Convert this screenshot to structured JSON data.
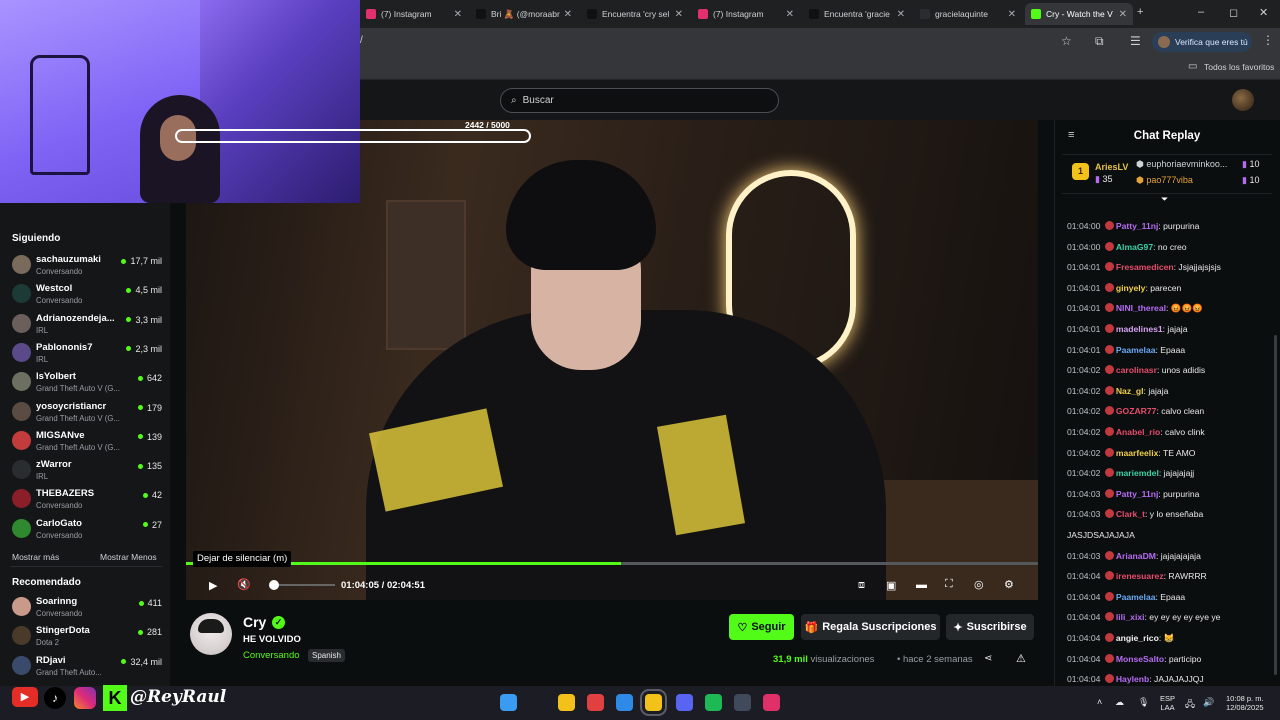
{
  "browser": {
    "tabs": [
      {
        "label": "(7) Instagram",
        "color": "#e1306c"
      },
      {
        "label": "Bri 🧸 (@moraabr",
        "color": "#111111"
      },
      {
        "label": "Encuentra 'cry sel",
        "color": "#111111"
      },
      {
        "label": "(7) Instagram",
        "color": "#e1306c"
      },
      {
        "label": "Encuentra 'gracie",
        "color": "#111111"
      },
      {
        "label": "gracielaquinte",
        "color": "#2a2d30"
      },
      {
        "label": "Cry - Watch the V",
        "color": "#53fc18"
      }
    ],
    "new_tab": "+",
    "window_controls": [
      "–",
      "◻",
      "✕"
    ],
    "url_fragment": "/",
    "verify_chip": "Verifica que eres tú",
    "bookmarks_label": "Todos los favoritos"
  },
  "header": {
    "search_placeholder": "Buscar"
  },
  "sidebar": {
    "following_title": "Siguiendo",
    "channels": [
      {
        "name": "sachauzumaki",
        "sub": "Conversando",
        "viewers": "17,7 mil",
        "color": "#7a6a5c"
      },
      {
        "name": "Westcol",
        "sub": "Conversando",
        "viewers": "4,5 mil",
        "color": "#1d3b36"
      },
      {
        "name": "Adrianozendeja...",
        "sub": "IRL",
        "viewers": "3,3 mil",
        "color": "#6a5f5a"
      },
      {
        "name": "Pablononis7",
        "sub": "IRL",
        "viewers": "2,3 mil",
        "color": "#5b4a8a"
      },
      {
        "name": "lsYolbert",
        "sub": "Grand Theft Auto V (G...",
        "viewers": "642",
        "color": "#6d7060"
      },
      {
        "name": "yosoycristiancr",
        "sub": "Grand Theft Auto V (G...",
        "viewers": "179",
        "color": "#5a4c43"
      },
      {
        "name": "MIGSANve",
        "sub": "Grand Theft Auto V (G...",
        "viewers": "139",
        "color": "#c23c3c"
      },
      {
        "name": "zWarror",
        "sub": "IRL",
        "viewers": "135",
        "color": "#2a2d30"
      },
      {
        "name": "THEBAZERS",
        "sub": "Conversando",
        "viewers": "42",
        "color": "#8a1f2a"
      },
      {
        "name": "CarloGato",
        "sub": "Conversando",
        "viewers": "27",
        "color": "#2f8a2f"
      }
    ],
    "show_more": "Mostrar más",
    "show_less": "Mostrar Menos",
    "recommended_title": "Recomendado",
    "recommended": [
      {
        "name": "Soarinng",
        "sub": "Conversando",
        "viewers": "411",
        "color": "#c99a8a"
      },
      {
        "name": "StingerDota",
        "sub": "Dota 2",
        "viewers": "281",
        "color": "#4a3a2a"
      },
      {
        "name": "RDjavi",
        "sub": "Grand Theft Auto...",
        "viewers": "32,4 mil",
        "color": "#3a4a6a"
      }
    ]
  },
  "player": {
    "goal_text": "2442  / 5000",
    "goal_progress": 0.49,
    "tooltip": "Dejar de silenciar (m)",
    "progress_fraction": 0.51,
    "current_time": "01:04:05",
    "time_sep": " / ",
    "duration": "02:04:51"
  },
  "stream": {
    "name": "Cry",
    "title": "HE VOLVIDO",
    "category": "Conversando",
    "language": "Spanish",
    "follow_label": "Seguir",
    "gift_label": "Regala Suscripciones",
    "subscribe_label": "Suscribirse",
    "views_number": "31,9 mil",
    "views_label": " visualizaciones",
    "time_ago": "hace 2 semanas"
  },
  "chat": {
    "title": "Chat Replay",
    "top_gifter": {
      "rank": "1",
      "name": "AriesLV",
      "count": "35"
    },
    "pinned_users": [
      {
        "name": "euphoriaevminkoo...",
        "count": "10"
      },
      {
        "name": "pao777viba",
        "count": "10"
      }
    ],
    "messages": [
      {
        "ts": "01:04:00",
        "user": "Patty_11nj",
        "color": "#b56cf2",
        "text": ": purpurina"
      },
      {
        "ts": "01:04:00",
        "user": "AlmaG97",
        "color": "#3ad2a5",
        "text": ": no creo"
      },
      {
        "ts": "01:04:01",
        "user": "Fresamedicen",
        "color": "#e64c6c",
        "text": ": Jsjajjajsjsjs"
      },
      {
        "ts": "01:04:01",
        "user": "ginyely",
        "color": "#f0d04a",
        "text": ": parecen"
      },
      {
        "ts": "01:04:01",
        "user": "NINI_thereal",
        "color": "#b56cf2",
        "text": ": 😡😡😡"
      },
      {
        "ts": "01:04:01",
        "user": "madelines1",
        "color": "#d8a2f2",
        "text": ": jajaja"
      },
      {
        "ts": "01:04:01",
        "user": "Paamelaa",
        "color": "#6aa8f2",
        "text": ": Epaaa"
      },
      {
        "ts": "01:04:02",
        "user": "carolinasr",
        "color": "#e64c6c",
        "text": ": unos adidis"
      },
      {
        "ts": "01:04:02",
        "user": "Naz_gl",
        "color": "#f0d04a",
        "text": ": jajaja"
      },
      {
        "ts": "01:04:02",
        "user": "GOZAR77",
        "color": "#e64c6c",
        "text": ": calvo clean"
      },
      {
        "ts": "01:04:02",
        "user": "Anabel_rio",
        "color": "#e64c6c",
        "text": ": calvo clink"
      },
      {
        "ts": "01:04:02",
        "user": "maarfeelix",
        "color": "#f0d04a",
        "text": ": TE AMO"
      },
      {
        "ts": "01:04:02",
        "user": "mariemdel",
        "color": "#3ad2a5",
        "text": ": jajajajajj"
      },
      {
        "ts": "01:04:03",
        "user": "Patty_11nj",
        "color": "#b56cf2",
        "text": ": purpurina"
      },
      {
        "ts": "01:04:03",
        "user": "Clark_t",
        "color": "#e64c6c",
        "text": ": y lo enseñaba"
      },
      {
        "ts": "",
        "user": "",
        "color": "#e8e8e8",
        "text": "JASJDSAJAJAJA"
      },
      {
        "ts": "01:04:03",
        "user": "ArianaDM",
        "color": "#b56cf2",
        "text": ": jajajajajaja"
      },
      {
        "ts": "01:04:04",
        "user": "irenesuarez",
        "color": "#e64c6c",
        "text": ": RAWRRR"
      },
      {
        "ts": "01:04:04",
        "user": "Paamelaa",
        "color": "#6aa8f2",
        "text": ": Epaaa"
      },
      {
        "ts": "01:04:04",
        "user": "lili_xixi",
        "color": "#b56cf2",
        "text": ": ey ey ey ey eye ye"
      },
      {
        "ts": "01:04:04",
        "user": "angie_rico",
        "color": "#f2f2f2",
        "text": ": 😸"
      },
      {
        "ts": "01:04:04",
        "user": "MonseSalto",
        "color": "#b56cf2",
        "text": ": participo"
      },
      {
        "ts": "01:04:04",
        "user": "Haylenb",
        "color": "#b56cf2",
        "text": ": JAJAJAJJQJ"
      }
    ]
  },
  "overlay": {
    "brand_text": "@ReyRaul"
  },
  "taskbar": {
    "lang_top": "ESP",
    "lang_bottom": "LAA",
    "time": "10:08 p. m.",
    "date": "12/08/2025",
    "icons": [
      "windows-icon",
      "search-icon",
      "file-explorer-icon",
      "app-icon",
      "edge-icon",
      "chrome-icon",
      "discord-icon",
      "spotify-icon",
      "steam-icon",
      "tiktok-icon"
    ]
  }
}
